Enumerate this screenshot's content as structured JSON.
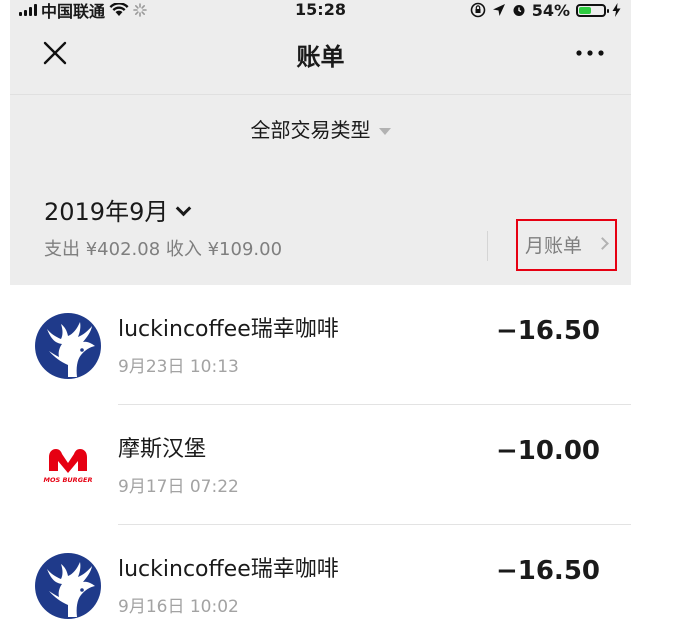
{
  "status_bar": {
    "carrier": "中国联通",
    "time": "15:28",
    "battery": "54%",
    "battery_level": 0.54
  },
  "nav": {
    "title": "账单",
    "close_icon": "close-icon",
    "more_icon": "more-dots-icon",
    "page_load_progress": 0.92
  },
  "filter": {
    "label": "全部交易类型"
  },
  "month": {
    "title": "2019年9月",
    "summary": "支出 ¥402.08 收入 ¥109.00",
    "monthly_bill_label": "月账单"
  },
  "transactions": [
    {
      "merchant": "luckincoffee瑞幸咖啡",
      "time": "9月23日 10:13",
      "amount": "−16.50",
      "logo": "luckin-deer-logo"
    },
    {
      "merchant": "摩斯汉堡",
      "time": "9月17日 07:22",
      "amount": "−10.00",
      "logo": "mos-burger-logo"
    },
    {
      "merchant": "luckincoffee瑞幸咖啡",
      "time": "9月16日 10:02",
      "amount": "−16.50",
      "logo": "luckin-deer-logo"
    }
  ],
  "colors": {
    "accent_green": "#07c160",
    "highlight_red": "#e60012",
    "luckin_blue": "#1f3a8a",
    "mos_red": "#e60012"
  }
}
